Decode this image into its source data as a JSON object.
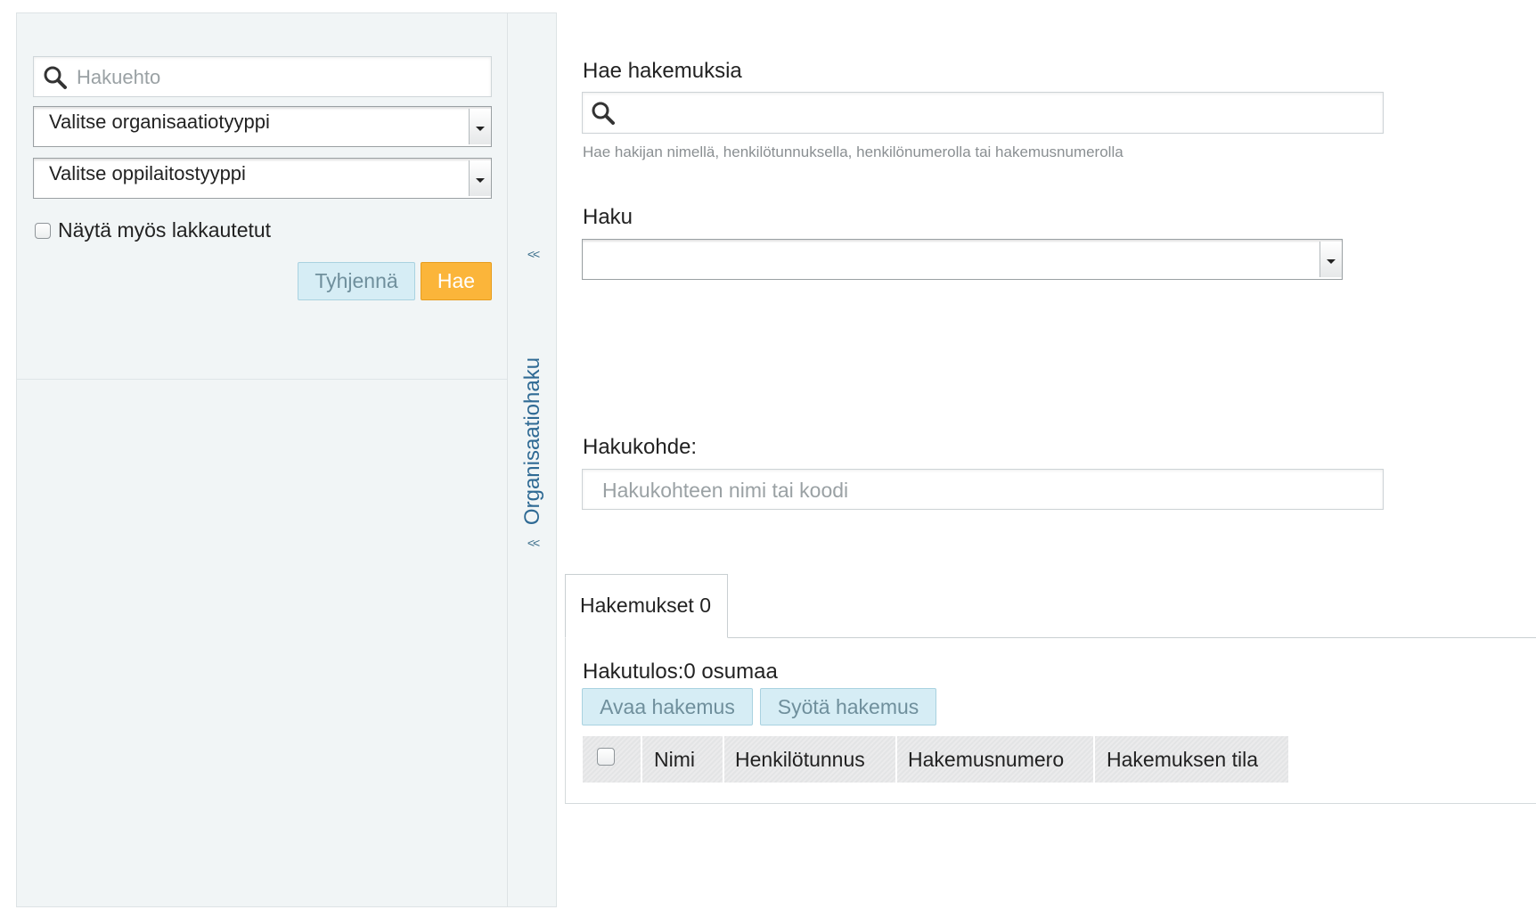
{
  "sidebar": {
    "search_placeholder": "Hakuehto",
    "org_type_select": "Valitse organisaatiotyyppi",
    "school_type_select": "Valitse oppilaitostyyppi",
    "show_closed_label": "Näytä myös lakkautetut",
    "clear_button": "Tyhjennä",
    "search_button": "Hae",
    "collapse_symbol": "<<",
    "vertical_label": "Organisaatiohaku"
  },
  "main": {
    "search_heading": "Hae hakemuksia",
    "search_hint": "Hae hakijan nimellä, henkilötunnuksella, henkilönumerolla tai hakemusnumerolla",
    "haku_label": "Haku",
    "haku_value": "",
    "hakukohde_label": "Hakukohde:",
    "hakukohde_placeholder": "Hakukohteen nimi tai koodi"
  },
  "results": {
    "tab_label": "Hakemukset 0",
    "result_text": "Hakutulos:0 osumaa",
    "open_button": "Avaa hakemus",
    "enter_button": "Syötä hakemus",
    "columns": [
      "Nimi",
      "Henkilötunnus",
      "Hakemusnumero",
      "Hakemuksen tila"
    ]
  },
  "colors": {
    "accent_orange": "#fbb53a",
    "light_button": "#d6edf5",
    "sidebar_bg": "#f1f5f6",
    "link_blue": "#2f6a94"
  },
  "icons": {
    "search": "search-icon",
    "dropdown": "chevron-down-icon",
    "collapse": "double-chevron-left-icon"
  }
}
